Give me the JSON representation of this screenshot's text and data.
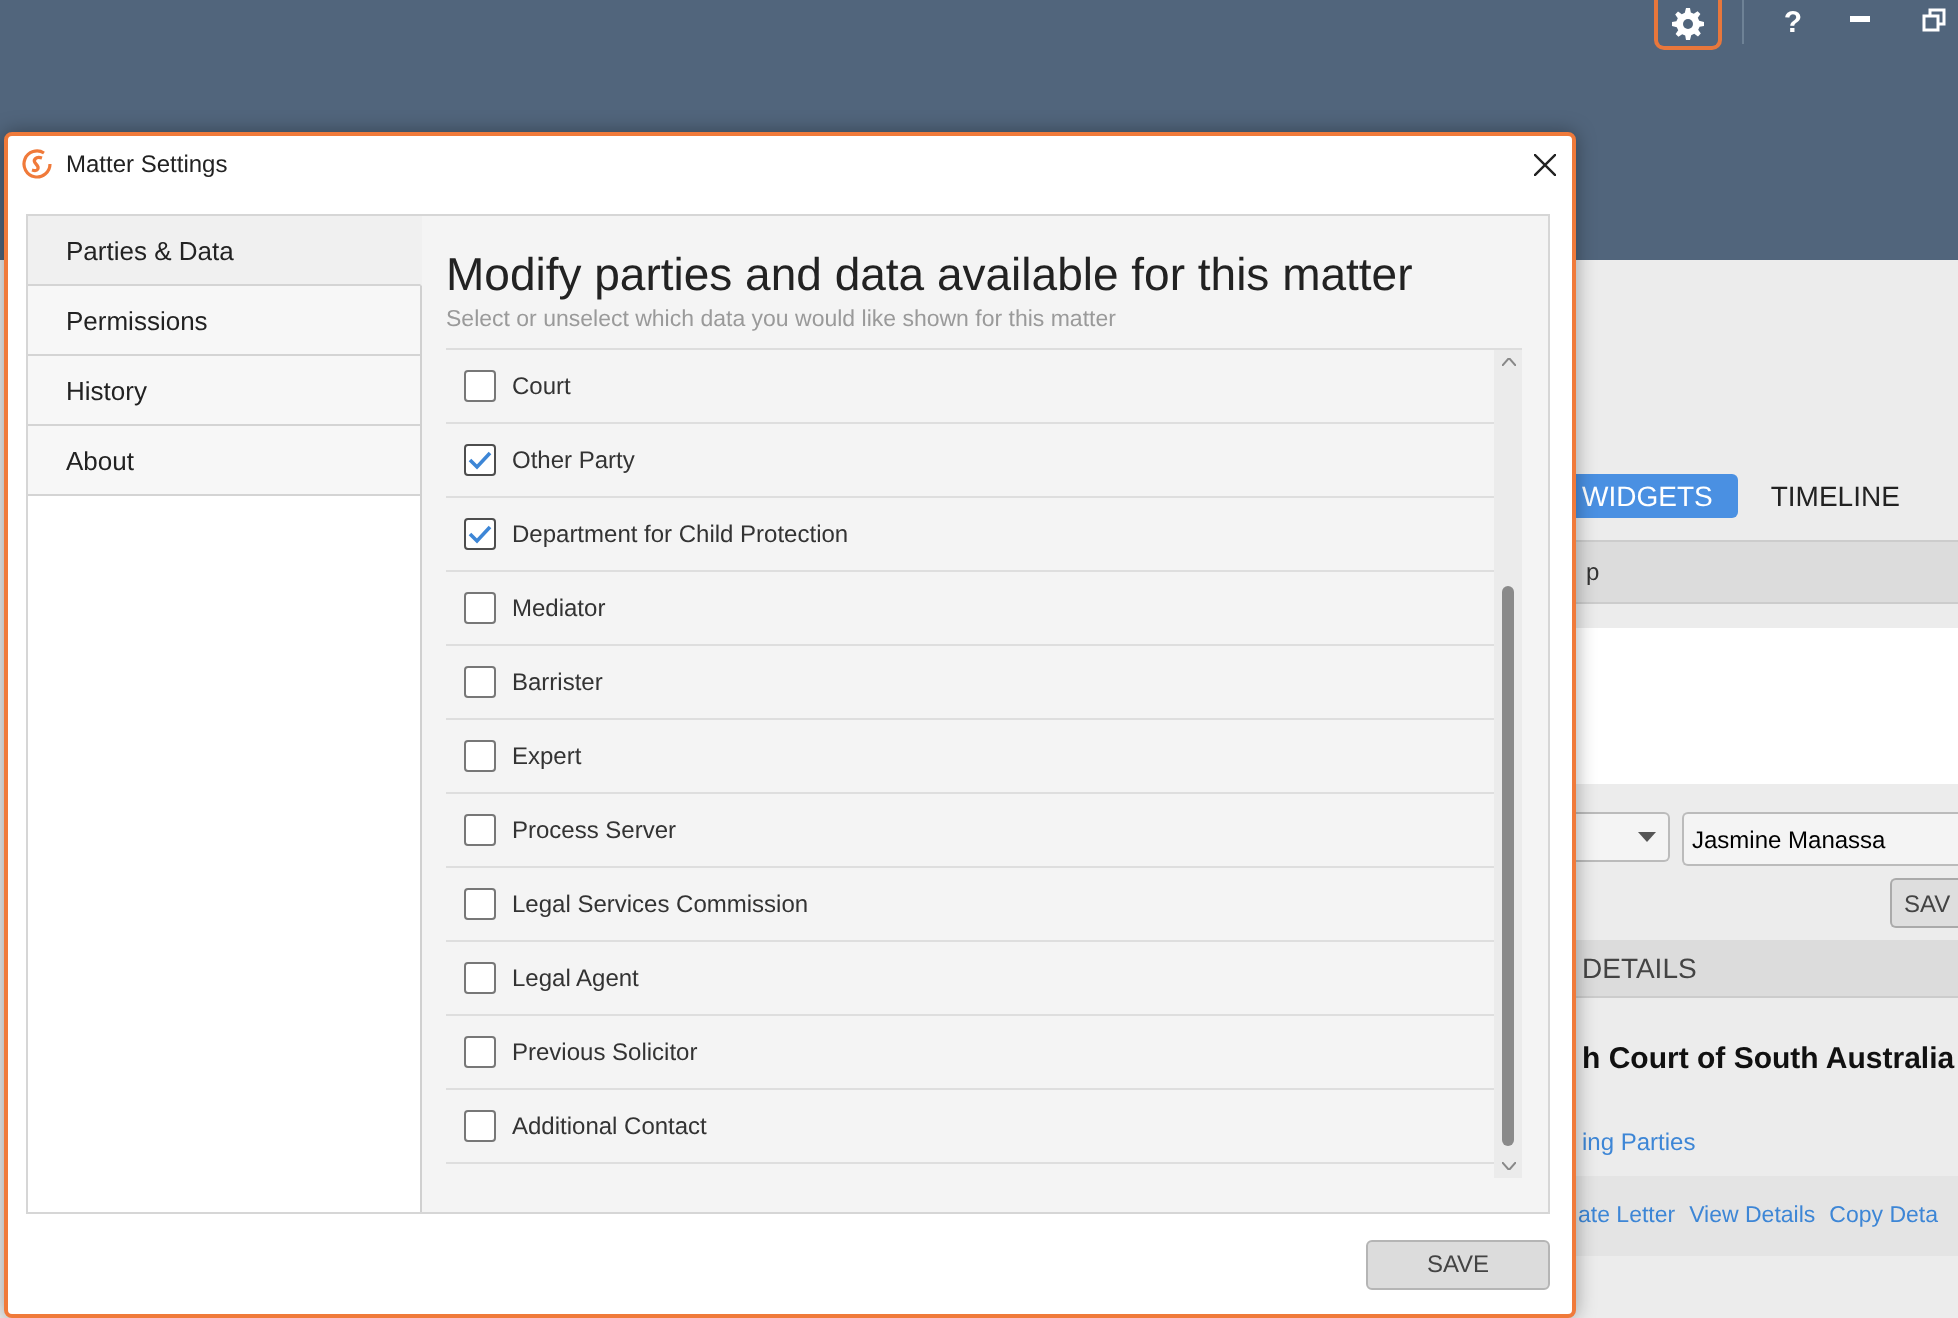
{
  "app_header": {
    "help_label": "?"
  },
  "background_panel": {
    "tabs": [
      {
        "label": "WIDGETS",
        "selected": true
      },
      {
        "label": "TIMELINE",
        "selected": false
      }
    ],
    "section_1_title": "p",
    "contact_value": "Jasmine Manassa",
    "save_label": "SAV",
    "section_2_title": "DETAILS",
    "court_name": "h Court of South Australia",
    "parties_link": "ing Parties",
    "actions": [
      "ate Letter",
      "View Details",
      "Copy Deta"
    ]
  },
  "dialog": {
    "title": "Matter Settings",
    "sidebar": [
      {
        "label": "Parties & Data",
        "selected": true
      },
      {
        "label": "Permissions",
        "selected": false
      },
      {
        "label": "History",
        "selected": false
      },
      {
        "label": "About",
        "selected": false
      }
    ],
    "heading": "Modify parties and data available for this matter",
    "subheading": "Select or unselect which data you would like shown for this matter",
    "options": [
      {
        "label": "Court",
        "checked": false
      },
      {
        "label": "Other Party",
        "checked": true
      },
      {
        "label": "Department for Child Protection",
        "checked": true
      },
      {
        "label": "Mediator",
        "checked": false
      },
      {
        "label": "Barrister",
        "checked": false
      },
      {
        "label": "Expert",
        "checked": false
      },
      {
        "label": "Process Server",
        "checked": false
      },
      {
        "label": "Legal Services Commission",
        "checked": false
      },
      {
        "label": "Legal Agent",
        "checked": false
      },
      {
        "label": "Previous Solicitor",
        "checked": false
      },
      {
        "label": "Additional Contact",
        "checked": false
      }
    ],
    "save_label": "SAVE"
  }
}
